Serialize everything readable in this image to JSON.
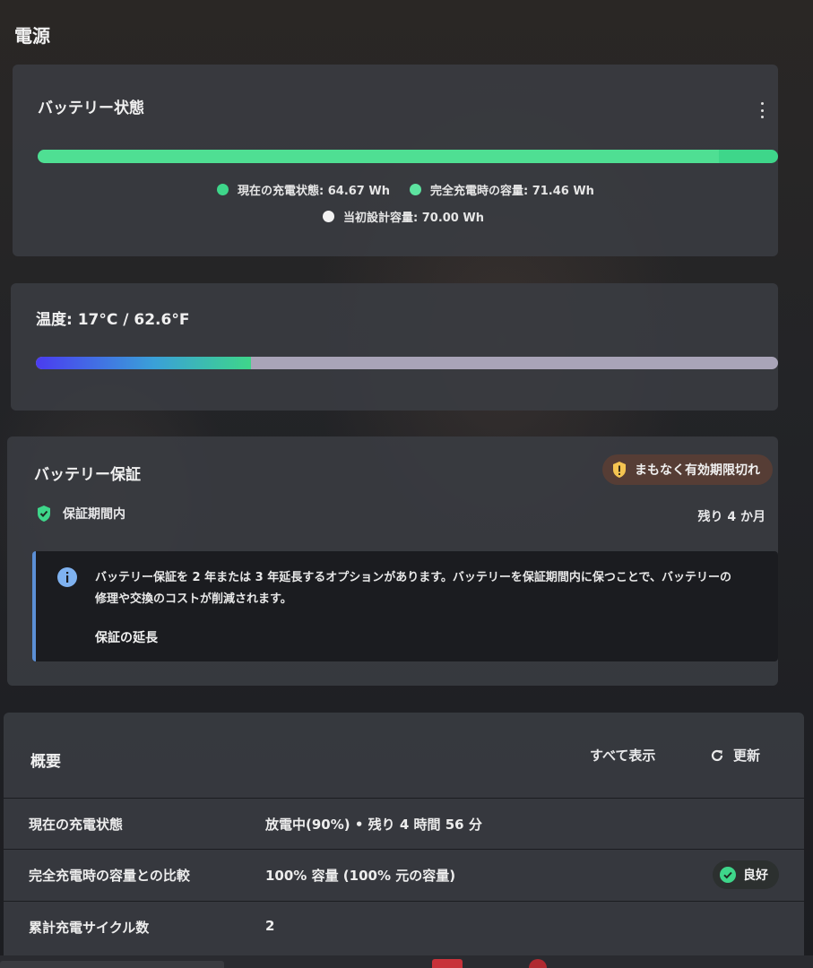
{
  "page": {
    "title": "電源"
  },
  "battery": {
    "title": "バッテリー状態",
    "current_fraction": 0.92,
    "full_fraction": 0.999,
    "legend": {
      "current": "現在の充電状態: 64.67 Wh",
      "full": "完全充電時の容量: 71.46 Wh",
      "design": "当初設計容量: 70.00 Wh"
    },
    "colors": {
      "current": "#3ed68a",
      "full": "#5de3a0",
      "design": "#f2f2f2"
    }
  },
  "temperature": {
    "label": "温度: 17°C / 62.6°F",
    "level_fraction": 0.29
  },
  "warranty": {
    "title": "バッテリー保証",
    "badge": "まもなく有効期限切れ",
    "status": "保証期間内",
    "remaining": "残り 4 か月",
    "info_line1": "バッテリー保証を 2 年または 3 年延長するオプションがあります。バッテリーを保証期間内に保つことで、バッテリーの",
    "info_line2": "修理や交換のコストが削減されます。",
    "extend_link": "保証の延長"
  },
  "overview": {
    "title": "概要",
    "show_all": "すべて表示",
    "refresh": "更新",
    "rows": [
      {
        "label": "現在の充電状態",
        "value": "放電中(90%) • 残り 4 時間 56 分"
      },
      {
        "label": "完全充電時の容量との比較",
        "value": "100% 容量 (100% 元の容量)",
        "badge": "良好"
      },
      {
        "label": "累計充電サイクル数",
        "value": "2"
      }
    ]
  }
}
